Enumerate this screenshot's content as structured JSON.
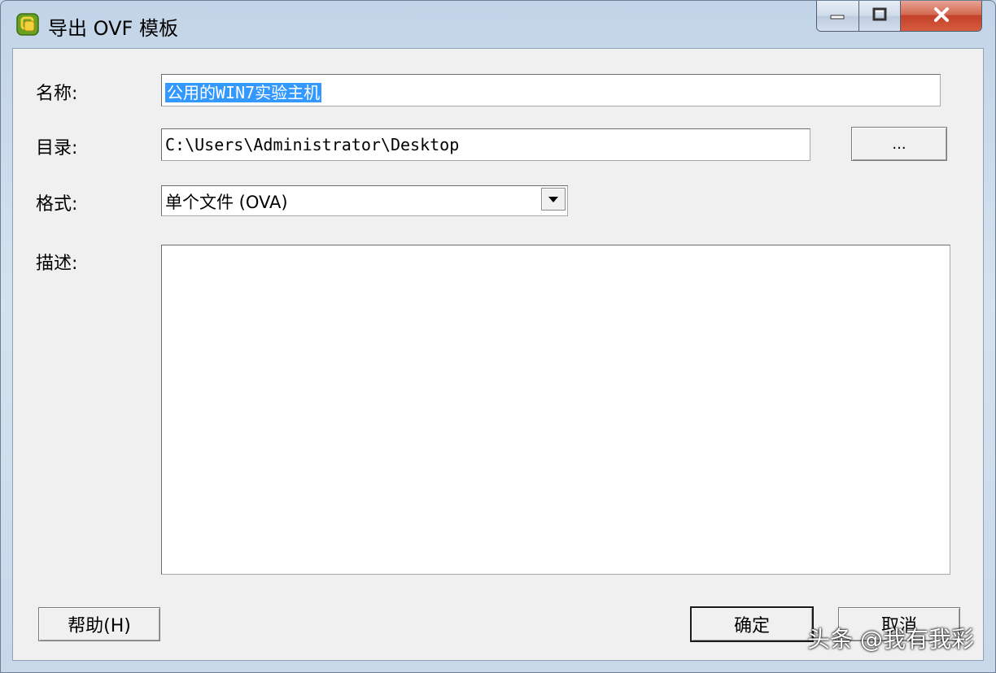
{
  "window": {
    "title": "导出 OVF 模板",
    "icon": "vsphere-app-icon",
    "controls": {
      "minimize": "minimize-icon",
      "maximize": "maximize-icon",
      "close": "close-icon"
    }
  },
  "form": {
    "name_label": "名称:",
    "name_value": "公用的WIN7实验主机",
    "directory_label": "目录:",
    "directory_value": "C:\\Users\\Administrator\\Desktop",
    "browse_label": "...",
    "format_label": "格式:",
    "format_value": "单个文件 (OVA)",
    "description_label": "描述:",
    "description_value": ""
  },
  "buttons": {
    "help": "帮助(H)",
    "ok": "确定",
    "cancel": "取消"
  },
  "watermark": "头条 @我有我彩",
  "colors": {
    "selection": "#3399ff",
    "close_button": "#c4402a"
  }
}
